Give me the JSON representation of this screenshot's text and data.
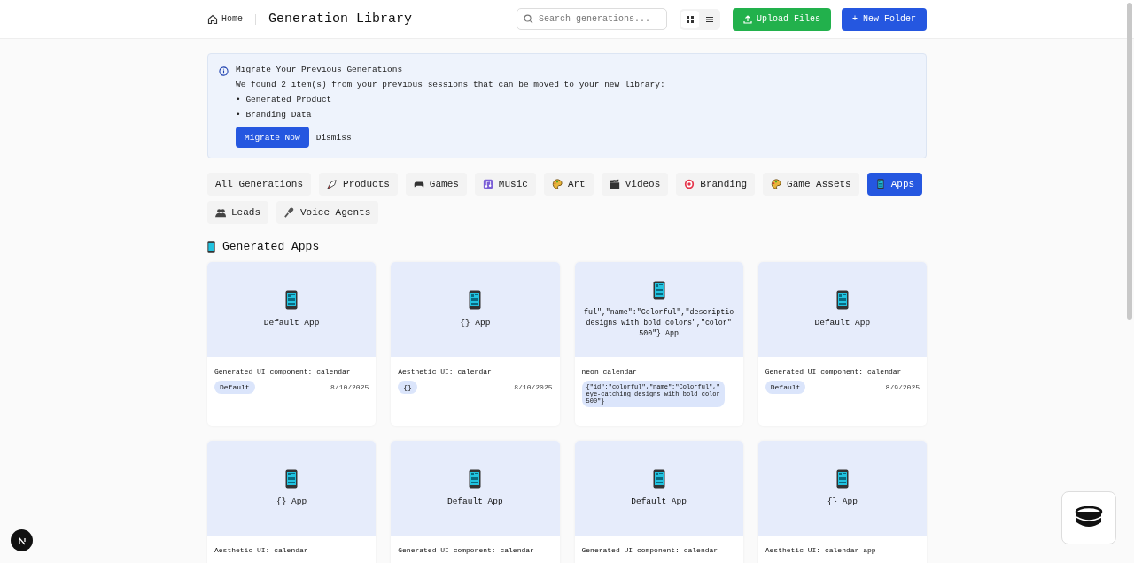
{
  "header": {
    "home_link": "Home",
    "title": "Generation Library",
    "search": {
      "placeholder": "Search generations..."
    },
    "view_toggle": [
      {
        "kind": "grid",
        "selected": true
      },
      {
        "kind": "list",
        "selected": false
      }
    ],
    "upload_button": "Upload Files",
    "new_folder_button": "+ New Folder"
  },
  "migration_banner": {
    "title": "Migrate Your Previous Generations",
    "message": "We found 2 item(s) from your previous sessions that can be moved to your new library:",
    "items": [
      "• Generated Product",
      "• Branding Data"
    ],
    "primary_button": "Migrate Now",
    "secondary_button": "Dismiss"
  },
  "category_tabs": [
    {
      "label": "All Generations",
      "selected": false
    },
    {
      "label": "Products",
      "selected": false
    },
    {
      "label": "Games",
      "selected": false
    },
    {
      "label": "Music",
      "selected": false
    },
    {
      "label": "Art",
      "selected": false
    },
    {
      "label": "Videos",
      "selected": false
    },
    {
      "label": "Branding",
      "selected": false
    },
    {
      "label": "Game Assets",
      "selected": false
    },
    {
      "label": "Apps",
      "selected": true
    },
    {
      "label": "Leads",
      "selected": false
    },
    {
      "label": "Voice Agents",
      "selected": false
    }
  ],
  "section_title": "Generated Apps",
  "cards": [
    {
      "title_lines": [
        "Default App"
      ],
      "description": "Generated UI component: calendar",
      "badge_lines": [
        "Default"
      ],
      "date": "8/10/2025"
    },
    {
      "title_lines": [
        "{} App"
      ],
      "description": "Aesthetic UI: calendar",
      "badge_lines": [
        "{}"
      ],
      "date": "8/10/2025"
    },
    {
      "title_lines": [
        "ful\",\"name\":\"Colorful\",\"descriptio",
        "designs with bold colors\",\"color\"",
        "500\"} App"
      ],
      "description": "neon calendar",
      "badge_lines": [
        "{\"id\":\"colorful\",\"name\":\"Colorful\",\"",
        "eye-catching designs with bold color",
        "500\"}"
      ]
    },
    {
      "title_lines": [
        "Default App"
      ],
      "description": "Generated UI component: calendar",
      "badge_lines": [
        "Default"
      ],
      "date": "8/9/2025"
    },
    {
      "title_lines": [
        "{} App"
      ],
      "description": "Aesthetic UI: calendar"
    },
    {
      "title_lines": [
        "Default App"
      ],
      "description": "Generated UI component: calendar"
    },
    {
      "title_lines": [
        "Default App"
      ],
      "description": "Generated UI component: calendar"
    },
    {
      "title_lines": [
        "{} App"
      ],
      "description": "Aesthetic UI: calendar app"
    }
  ]
}
